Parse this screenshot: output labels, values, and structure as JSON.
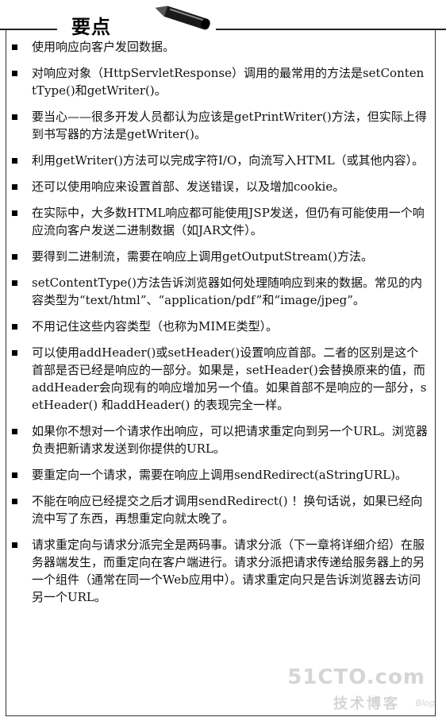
{
  "header": {
    "title": "要点"
  },
  "items": [
    "使用响应向客户发回数据。",
    "对响应对象（HttpServletResponse）调用的最常用的方法是setContentType()和getWriter()。",
    "要当心——很多开发人员都认为应该是getPrintWriter()方法，但实际上得到书写器的方法是getWriter()。",
    "利用getWriter()方法可以完成字符I/O，向流写入HTML（或其他内容）。",
    "还可以使用响应来设置首部、发送错误，以及增加cookie。",
    "在实际中，大多数HTML响应都可能使用JSP发送，但仍有可能使用一个响应流向客户发送二进制数据（如JAR文件）。",
    "要得到二进制流，需要在响应上调用getOutputStream()方法。",
    "setContentType()方法告诉浏览器如何处理随响应到来的数据。常见的内容类型为“text/html”、“application/pdf”和“image/jpeg”。",
    "不用记住这些内容类型（也称为MIME类型）。",
    "可以使用addHeader()或setHeader()设置响应首部。二者的区别是这个首部是否已经是响应的一部分。如果是，setHeader()会替换原来的值，而addHeader会向现有的响应增加另一个值。如果首部不是响应的一部分，setHeader() 和addHeader() 的表现完全一样。",
    "如果你不想对一个请求作出响应，可以把请求重定向到另一个URL。浏览器负责把新请求发送到你提供的URL。",
    "要重定向一个请求，需要在响应上调用sendRedirect(aStringURL)。",
    "不能在响应已经提交之后才调用sendRedirect() ！换句话说，如果已经向流中写了东西，再想重定向就太晚了。",
    "请求重定向与请求分派完全是两码事。请求分派（下一章将详细介绍）在服务器端发生，而重定向在客户端进行。请求分派把请求传递给服务器上的另一个组件（通常在同一个Web应用中）。请求重定向只是告诉浏览器去访问另一个URL。"
  ],
  "watermark": {
    "site": "51CTO.com",
    "label": "技术博客",
    "blog": "Blog"
  },
  "colors": {
    "text": "#111111",
    "border": "#333333",
    "background": "#ffffff"
  },
  "icons": {
    "title_decoration": "pencil-icon",
    "bullet": "square-bullet"
  }
}
